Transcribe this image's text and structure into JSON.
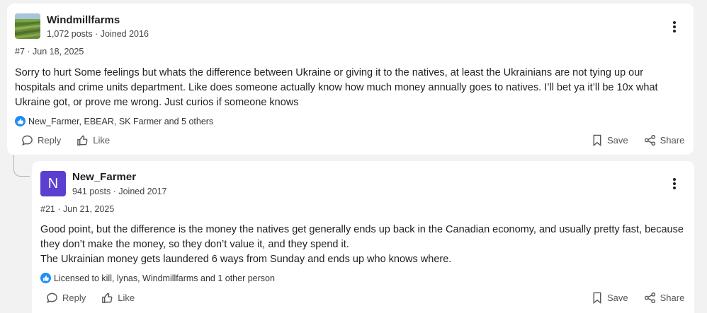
{
  "posts": [
    {
      "username": "Windmillfarms",
      "posts_count": "1,072 posts",
      "joined": "Joined 2016",
      "post_number": "#7",
      "date": "Jun 18, 2025",
      "body": [
        "Sorry to hurt Some feelings but whats the difference between Ukraine or giving it to the natives, at least the Ukrainians are not tying up our hospitals and crime units department. Like does someone actually know how much money annually goes to natives. I’ll bet ya it’ll be 10x what Ukraine got, or prove me wrong. Just curios if someone knows"
      ],
      "reactions": "New_Farmer, EBEAR, SK Farmer and 5 others"
    },
    {
      "username": "New_Farmer",
      "avatar_letter": "N",
      "posts_count": "941 posts",
      "joined": "Joined 2017",
      "post_number": "#21",
      "date": "Jun 21, 2025",
      "body": [
        "Good point, but the difference is the money the natives get generally ends up back in the Canadian economy, and usually pretty fast, because they don’t make the money, so they don’t value it, and they spend it.",
        "The Ukrainian money gets laundered 6 ways from Sunday and ends up who knows where."
      ],
      "reactions": "Licensed to kill, lynas, Windmillfarms and 1 other person"
    }
  ],
  "actions": {
    "reply": "Reply",
    "like": "Like",
    "save": "Save",
    "share": "Share"
  },
  "separator": "·",
  "colors": {
    "avatar_bg": "#5b3fd1",
    "like_badge": "#1e8ef5"
  },
  "icons": [
    "more-vertical-icon",
    "thumbs-up-icon",
    "reply-bubble-icon",
    "like-icon",
    "bookmark-icon",
    "share-icon"
  ]
}
